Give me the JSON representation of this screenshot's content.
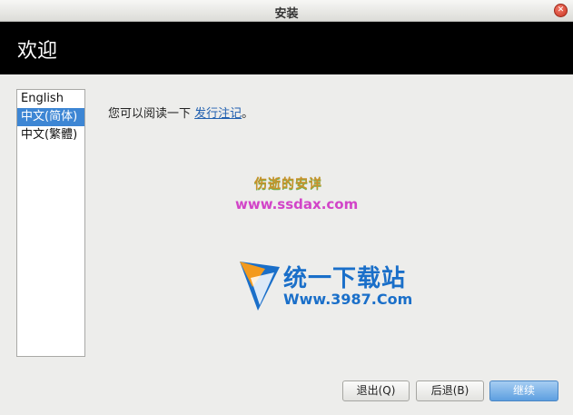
{
  "window": {
    "title": "安装"
  },
  "header": {
    "title": "欢迎"
  },
  "languages": {
    "items": [
      {
        "label": "English"
      },
      {
        "label": "中文(简体)",
        "selected": true
      },
      {
        "label": "中文(繁體)"
      }
    ]
  },
  "release_notes": {
    "prefix": "您可以阅读一下 ",
    "link": "发行注记",
    "suffix": "。"
  },
  "watermark": {
    "line1": "伤逝的安详",
    "line2": "www.ssdax.com"
  },
  "logo": {
    "name": "统一下载站",
    "url": "Www.3987.Com"
  },
  "buttons": {
    "quit": "退出(Q)",
    "back": "后退(B)",
    "continue": "继续"
  }
}
